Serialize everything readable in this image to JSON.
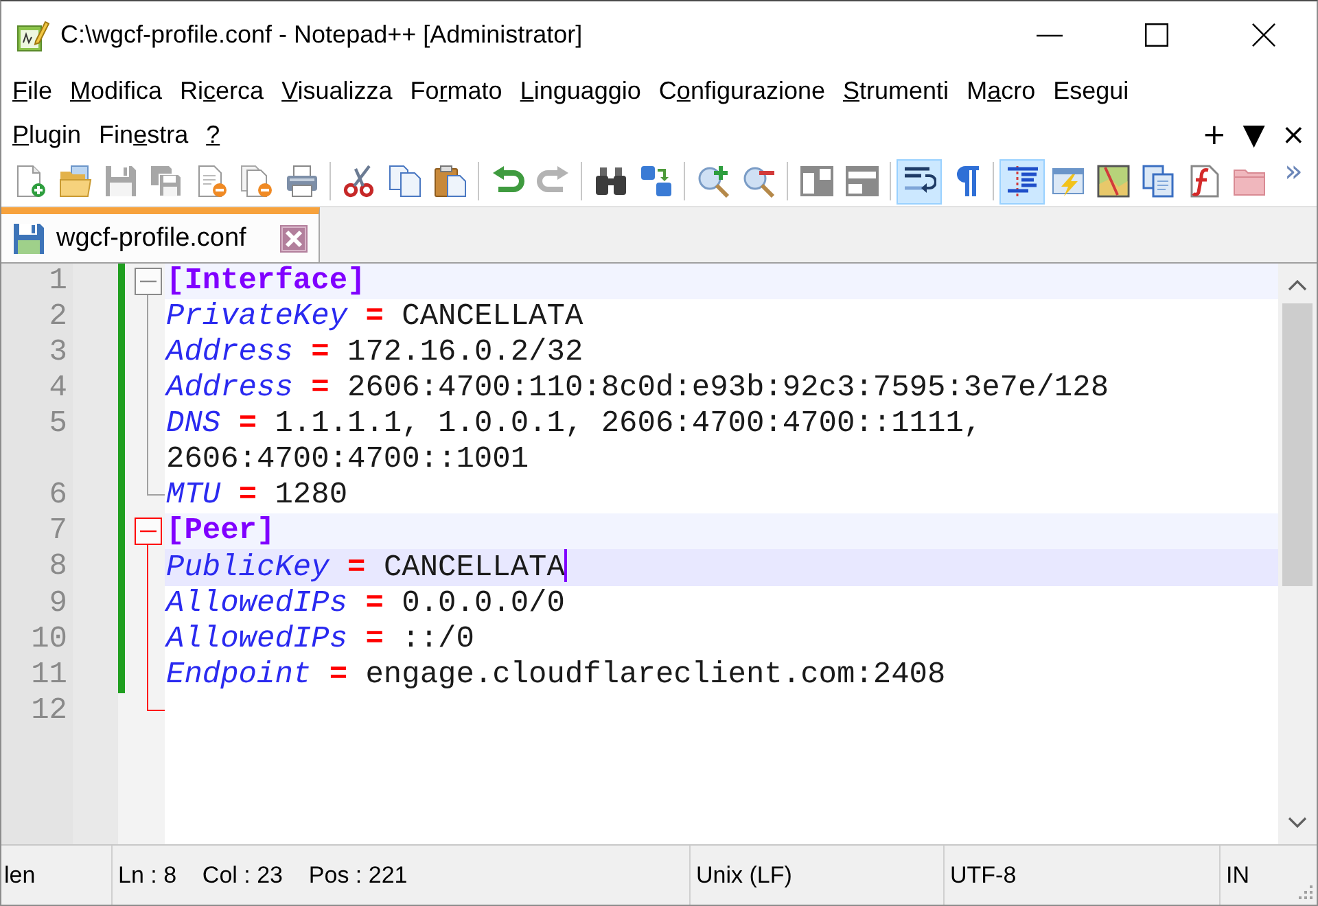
{
  "window": {
    "title": "C:\\wgcf-profile.conf - Notepad++ [Administrator]"
  },
  "menu_bar": {
    "rows": [
      [
        {
          "key": "F",
          "post": "ile"
        },
        {
          "key": "M",
          "post": "odifica"
        },
        {
          "pre": "Ri",
          "key": "c",
          "post": "erca"
        },
        {
          "key": "V",
          "post": "isualizza"
        },
        {
          "pre": "Fo",
          "key": "r",
          "post": "mato"
        },
        {
          "key": "L",
          "post": "inguaggio"
        },
        {
          "pre": "C",
          "key": "o",
          "post": "nfigurazione"
        },
        {
          "key": "S",
          "post": "trumenti"
        },
        {
          "pre": "M",
          "key": "a",
          "post": "cro"
        },
        {
          "pre": "Ese",
          "key": "g",
          "post": "ui"
        }
      ],
      [
        {
          "key": "P",
          "post": "lugin"
        },
        {
          "pre": "Fin",
          "key": "e",
          "post": "stra"
        },
        {
          "key": "?"
        }
      ]
    ],
    "document_controls": [
      "+",
      "▼",
      "×"
    ]
  },
  "toolbar": {
    "groups": [
      {
        "buttons": [
          {
            "pressed": false,
            "disabled": false
          },
          {
            "pressed": false,
            "disabled": false
          },
          {
            "pressed": false,
            "disabled": true
          },
          {
            "pressed": false,
            "disabled": true
          },
          {
            "pressed": false,
            "disabled": false
          },
          {
            "pressed": false,
            "disabled": false
          },
          {
            "pressed": false,
            "disabled": false
          }
        ]
      },
      {
        "buttons": [
          {
            "pressed": false,
            "disabled": false
          },
          {
            "pressed": false,
            "disabled": false
          },
          {
            "pressed": false,
            "disabled": false
          }
        ]
      },
      {
        "buttons": [
          {
            "pressed": false,
            "disabled": false
          },
          {
            "pressed": false,
            "disabled": true
          }
        ]
      },
      {
        "buttons": [
          {
            "pressed": false,
            "disabled": false
          },
          {
            "pressed": false,
            "disabled": false
          }
        ]
      },
      {
        "buttons": [
          {
            "pressed": false,
            "disabled": false
          },
          {
            "pressed": false,
            "disabled": false
          }
        ]
      },
      {
        "buttons": [
          {
            "pressed": false,
            "disabled": false
          },
          {
            "pressed": false,
            "disabled": false
          }
        ]
      },
      {
        "buttons": [
          {
            "pressed": true,
            "disabled": false
          },
          {
            "pressed": false,
            "disabled": false
          }
        ]
      },
      {
        "buttons": [
          {
            "pressed": true,
            "disabled": false
          },
          {
            "pressed": false,
            "disabled": false
          },
          {
            "pressed": false,
            "disabled": false
          },
          {
            "pressed": false,
            "disabled": false
          },
          {
            "pressed": false,
            "disabled": false
          },
          {
            "pressed": false,
            "disabled": false
          }
        ]
      }
    ],
    "overflow": "»"
  },
  "tabs": [
    {
      "label": "wgcf-profile.conf",
      "selected": true,
      "modified": false
    }
  ],
  "editor": {
    "blocks": [
      {
        "number": "1",
        "kind": "section",
        "text": "[Interface]",
        "expanded": true,
        "active": false,
        "modified": true,
        "caret": false,
        "children": [
          {
            "number": "2",
            "kind": "pair",
            "key": "PrivateKey",
            "operator": "=",
            "value": "CANCELLATA",
            "modified": true,
            "caret": false
          },
          {
            "number": "3",
            "kind": "pair",
            "key": "Address",
            "operator": "=",
            "value": "172.16.0.2/32",
            "modified": true,
            "caret": false
          },
          {
            "number": "4",
            "kind": "pair",
            "key": "Address",
            "operator": "=",
            "value": "2606:4700:110:8c0d:e93b:92c3:7595:3e7e/128",
            "modified": true,
            "caret": false
          },
          {
            "number": "5",
            "kind": "pair",
            "key": "DNS",
            "operator": "=",
            "value": "1.1.1.1, 1.0.0.1, 2606:4700:4700::1111, 2606:4700:4700::1001",
            "modified": true,
            "caret": false
          },
          {
            "number": "6",
            "kind": "pair",
            "key": "MTU",
            "operator": "=",
            "value": "1280",
            "modified": true,
            "caret": false
          }
        ]
      },
      {
        "number": "7",
        "kind": "section",
        "text": "[Peer]",
        "expanded": true,
        "active": true,
        "modified": true,
        "caret": false,
        "children": [
          {
            "number": "8",
            "kind": "pair",
            "key": "PublicKey",
            "operator": "=",
            "value": "CANCELLATA",
            "modified": true,
            "caret": true
          },
          {
            "number": "9",
            "kind": "pair",
            "key": "AllowedIPs",
            "operator": "=",
            "value": "0.0.0.0/0",
            "modified": true,
            "caret": false
          },
          {
            "number": "10",
            "kind": "pair",
            "key": "AllowedIPs",
            "operator": "=",
            "value": "::/0",
            "modified": true,
            "caret": false
          },
          {
            "number": "11",
            "kind": "pair",
            "key": "Endpoint",
            "operator": "=",
            "value": "engage.cloudflareclient.com:2408",
            "modified": true,
            "caret": false
          },
          {
            "number": "12",
            "kind": "blank",
            "modified": false,
            "caret": false
          }
        ]
      }
    ]
  },
  "status_bar": {
    "panels": [
      "len",
      "Ln : 8    Col : 23    Pos : 221",
      "Unix (LF)",
      "UTF-8",
      "IN"
    ]
  }
}
